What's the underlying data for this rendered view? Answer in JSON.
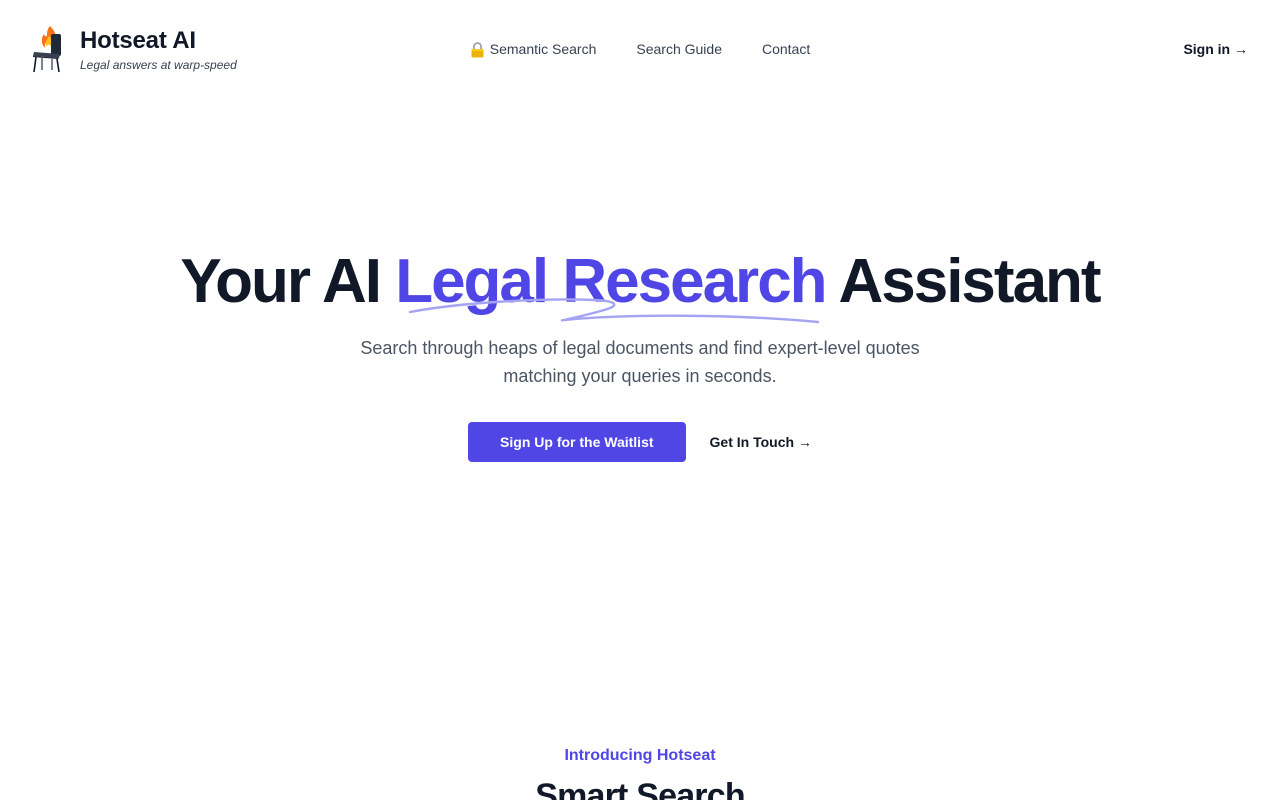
{
  "brand": {
    "title": "Hotseat AI",
    "tagline": "Legal answers at warp-speed",
    "logo_icon": "burning-chair-icon"
  },
  "nav": {
    "items": [
      {
        "label": "Semantic Search",
        "icon": "lock-icon"
      },
      {
        "label": "Search Guide"
      },
      {
        "label": "Contact"
      }
    ],
    "signin_label": "Sign in →"
  },
  "hero": {
    "title_before": "Your AI ",
    "title_accent": "Legal Research",
    "title_after": " Assistant",
    "subtitle": "Search through heaps of legal documents and find expert-level quotes matching your queries in seconds.",
    "primary_cta": "Sign Up for the Waitlist",
    "secondary_cta": "Get In Touch →"
  },
  "section": {
    "eyebrow": "Introducing Hotseat",
    "title": "Smart Search"
  },
  "colors": {
    "accent": "#4f46e5",
    "text": "#111827",
    "muted": "#4b5563",
    "scribble": "#a5a3f3"
  }
}
